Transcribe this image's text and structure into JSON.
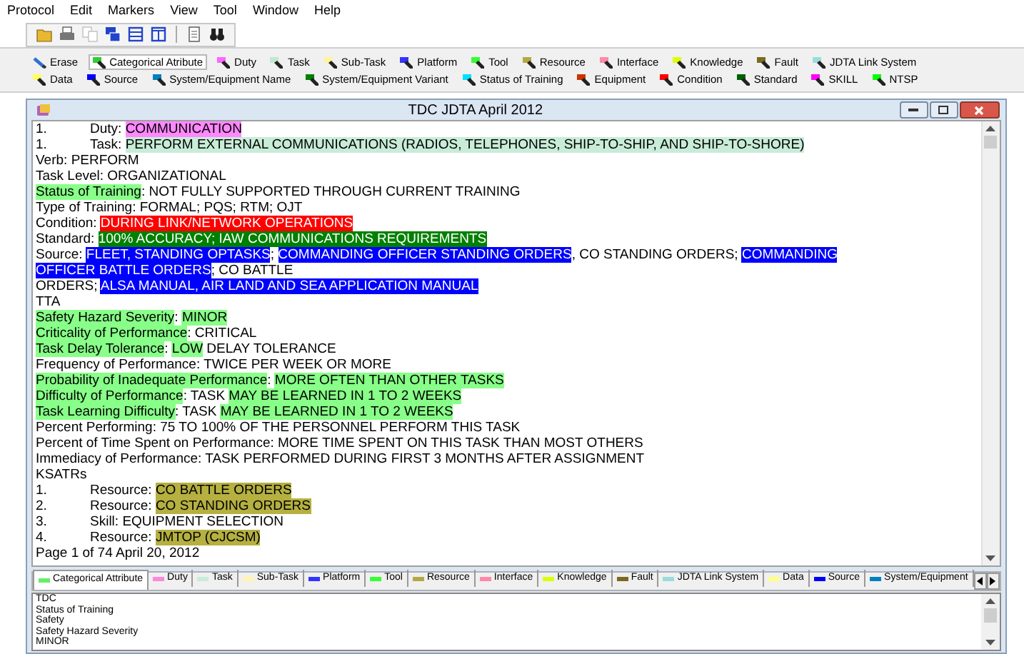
{
  "menu": [
    "Protocol",
    "Edit",
    "Markers",
    "View",
    "Tool",
    "Window",
    "Help"
  ],
  "toolbar": [
    {
      "kind": "open"
    },
    {
      "kind": "print"
    },
    {
      "kind": "copy",
      "disabled": true
    },
    {
      "kind": "cascade"
    },
    {
      "kind": "tile_h"
    },
    {
      "kind": "tile_v"
    },
    {
      "kind": "sep"
    },
    {
      "kind": "page"
    },
    {
      "kind": "find"
    }
  ],
  "marker_rows": [
    [
      {
        "kind": "erase",
        "label": "Erase",
        "selected": false
      },
      {
        "kind": "marker",
        "label": "Categorical Atribute",
        "color": "#33cc33",
        "selected": true
      },
      {
        "kind": "marker",
        "label": "Duty",
        "color": "#ff66ff",
        "selected": false
      },
      {
        "kind": "marker",
        "label": "Task",
        "color": "#bfe8d0",
        "selected": false
      },
      {
        "kind": "marker",
        "label": "Sub-Task",
        "color": "#fff3a0",
        "selected": false
      },
      {
        "kind": "marker",
        "label": "Platform",
        "color": "#3333ff",
        "selected": false
      },
      {
        "kind": "marker",
        "label": "Tool",
        "color": "#33ff33",
        "selected": false
      },
      {
        "kind": "marker",
        "label": "Resource",
        "color": "#b5a842",
        "selected": false
      },
      {
        "kind": "marker",
        "label": "Interface",
        "color": "#ff88aa",
        "selected": false
      },
      {
        "kind": "marker",
        "label": "Knowledge",
        "color": "#ddff00",
        "selected": false
      },
      {
        "kind": "marker",
        "label": "Fault",
        "color": "#7a6a20",
        "selected": false
      },
      {
        "kind": "marker",
        "label": "JDTA Link System",
        "color": "#99dddd",
        "selected": false
      }
    ],
    [
      {
        "kind": "marker",
        "label": "Data",
        "color": "#ffff66",
        "selected": false
      },
      {
        "kind": "marker",
        "label": "Source",
        "color": "#0000ff",
        "selected": false
      },
      {
        "kind": "marker",
        "label": "System/Equipment Name",
        "color": "#0080c0",
        "selected": false
      },
      {
        "kind": "marker",
        "label": "System/Equipment Variant",
        "color": "#008000",
        "selected": false
      },
      {
        "kind": "marker",
        "label": "Status of Training",
        "color": "#00e0ff",
        "selected": false
      },
      {
        "kind": "marker",
        "label": "Equipment",
        "color": "#cc3300",
        "selected": false
      },
      {
        "kind": "marker",
        "label": "Condition",
        "color": "#ff0000",
        "selected": false
      },
      {
        "kind": "marker",
        "label": "Standard",
        "color": "#006000",
        "selected": false
      },
      {
        "kind": "marker",
        "label": "SKILL",
        "color": "#ff00ff",
        "selected": false
      },
      {
        "kind": "marker",
        "label": "NTSP",
        "color": "#00ff00",
        "selected": false
      }
    ]
  ],
  "window": {
    "title": "TDC JDTA April 2012"
  },
  "document": [
    {
      "number": "1.",
      "segments": [
        {
          "text": "Duty: "
        },
        {
          "text": "COMMUNICATION",
          "color": "#ff88ff"
        }
      ]
    },
    {
      "number": "1.",
      "segments": [
        {
          "text": "Task: "
        },
        {
          "text": "PERFORM EXTERNAL COMMUNICATIONS (RADIOS, TELEPHONES, SHIP-TO-SHIP, AND SHIP-TO-SHORE)",
          "color": "#c8ecd8"
        }
      ]
    },
    {
      "segments": [
        {
          "text": "Verb: PERFORM"
        }
      ]
    },
    {
      "segments": [
        {
          "text": "Task Level: ORGANIZATIONAL"
        }
      ]
    },
    {
      "segments": [
        {
          "text": "Status of Training",
          "color": "#88ff88"
        },
        {
          "text": ": NOT FULLY SUPPORTED THROUGH CURRENT TRAINING"
        }
      ]
    },
    {
      "segments": [
        {
          "text": "Type of Training: FORMAL; PQS; RTM; OJT"
        }
      ]
    },
    {
      "segments": [
        {
          "text": "Condition: "
        },
        {
          "text": "DURING LINK/NETWORK OPERATIONS",
          "color": "#ff0000"
        }
      ]
    },
    {
      "segments": [
        {
          "text": "Standard: "
        },
        {
          "text": "100% ACCURACY; IAW COMMUNICATIONS REQUIREMENTS",
          "color": "#008000"
        }
      ]
    },
    {
      "segments": [
        {
          "text": "Source: "
        },
        {
          "text": "FLEET, STANDING OPTASKS",
          "color": "#0000ff"
        },
        {
          "text": "; "
        },
        {
          "text": "COMMANDING OFFICER STANDING ORDERS",
          "color": "#0000ff"
        },
        {
          "text": ", CO STANDING ORDERS; "
        },
        {
          "text": "COMMANDING",
          "color": "#0000ff"
        }
      ]
    },
    {
      "segments": [
        {
          "text": "OFFICER BATTLE ORDERS",
          "color": "#0000ff"
        },
        {
          "text": "; CO BATTLE"
        }
      ]
    },
    {
      "segments": [
        {
          "text": "ORDERS; "
        },
        {
          "text": "ALSA MANUAL, AIR LAND AND SEA APPLICATION MANUAL",
          "color": "#0000ff"
        }
      ]
    },
    {
      "segments": [
        {
          "text": "TTA"
        }
      ]
    },
    {
      "segments": [
        {
          "text": "Safety Hazard Severity",
          "color": "#88ff88"
        },
        {
          "text": ": "
        },
        {
          "text": "MINOR",
          "color": "#88ff88"
        }
      ]
    },
    {
      "segments": [
        {
          "text": "Criticality of Performance",
          "color": "#88ff88"
        },
        {
          "text": ": CRITICAL"
        }
      ]
    },
    {
      "segments": [
        {
          "text": "Task Delay Tolerance",
          "color": "#88ff88"
        },
        {
          "text": ": "
        },
        {
          "text": "LOW",
          "color": "#88ff88"
        },
        {
          "text": " DELAY TOLERANCE"
        }
      ]
    },
    {
      "segments": [
        {
          "text": "Frequency of Performance: TWICE PER WEEK OR MORE"
        }
      ]
    },
    {
      "segments": [
        {
          "text": "Probability of Inadequate Performance",
          "color": "#88ff88"
        },
        {
          "text": ": "
        },
        {
          "text": "MORE OFTEN THAN OTHER TASKS",
          "color": "#88ff88"
        }
      ]
    },
    {
      "segments": [
        {
          "text": "Difficulty of Performance",
          "color": "#88ff88"
        },
        {
          "text": ": TASK "
        },
        {
          "text": "MAY BE LEARNED IN 1 TO 2 WEEKS",
          "color": "#88ff88"
        }
      ]
    },
    {
      "segments": [
        {
          "text": "Task Learning Difficulty",
          "color": "#88ff88"
        },
        {
          "text": ": TASK "
        },
        {
          "text": "MAY BE LEARNED IN 1 TO 2 WEEKS",
          "color": "#88ff88"
        }
      ]
    },
    {
      "segments": [
        {
          "text": "Percent Performing: 75 TO 100% OF THE PERSONNEL PERFORM THIS TASK"
        }
      ]
    },
    {
      "segments": [
        {
          "text": "Percent of Time Spent on Performance: MORE TIME SPENT ON THIS TASK THAN MOST OTHERS"
        }
      ]
    },
    {
      "segments": [
        {
          "text": "Immediacy of Performance: TASK PERFORMED DURING FIRST 3 MONTHS AFTER ASSIGNMENT"
        }
      ]
    },
    {
      "segments": [
        {
          "text": "KSATRs"
        }
      ]
    },
    {
      "number": "1.",
      "segments": [
        {
          "text": "Resource: "
        },
        {
          "text": "CO BATTLE ORDERS",
          "color": "#b5b040"
        }
      ]
    },
    {
      "number": "2.",
      "segments": [
        {
          "text": "Resource: "
        },
        {
          "text": "CO STANDING ORDERS",
          "color": "#b5b040"
        }
      ]
    },
    {
      "number": "3.",
      "segments": [
        {
          "text": "Skill: EQUIPMENT SELECTION"
        }
      ]
    },
    {
      "number": "4.",
      "segments": [
        {
          "text": "Resource: "
        },
        {
          "text": "JMTOP (CJCSM)",
          "color": "#b5b040"
        }
      ]
    },
    {
      "segments": [
        {
          "text": "Page 1 of 74 April 20, 2012"
        }
      ]
    }
  ],
  "tabs": [
    {
      "label": "Categorical Attribute",
      "color": "#66ee66",
      "selected": true
    },
    {
      "label": "Duty",
      "color": "#ff88dd",
      "selected": false
    },
    {
      "label": "Task",
      "color": "#c8ecd8",
      "selected": false
    },
    {
      "label": "Sub-Task",
      "color": "#fff3b0",
      "selected": false
    },
    {
      "label": "Platform",
      "color": "#3333ff",
      "selected": false
    },
    {
      "label": "Tool",
      "color": "#33ff33",
      "selected": false
    },
    {
      "label": "Resource",
      "color": "#b5a842",
      "selected": false
    },
    {
      "label": "Interface",
      "color": "#ff88aa",
      "selected": false
    },
    {
      "label": "Knowledge",
      "color": "#ddff00",
      "selected": false
    },
    {
      "label": "Fault",
      "color": "#7a6a20",
      "selected": false
    },
    {
      "label": "JDTA Link System",
      "color": "#99dddd",
      "selected": false
    },
    {
      "label": "Data",
      "color": "#ffff88",
      "selected": false
    },
    {
      "label": "Source",
      "color": "#0000ff",
      "selected": false
    },
    {
      "label": "System/Equipment",
      "color": "#0080c0",
      "selected": false
    }
  ],
  "list": [
    "TDC",
    "Status of Training",
    "Safety",
    "Safety Hazard Severity",
    "MINOR"
  ]
}
